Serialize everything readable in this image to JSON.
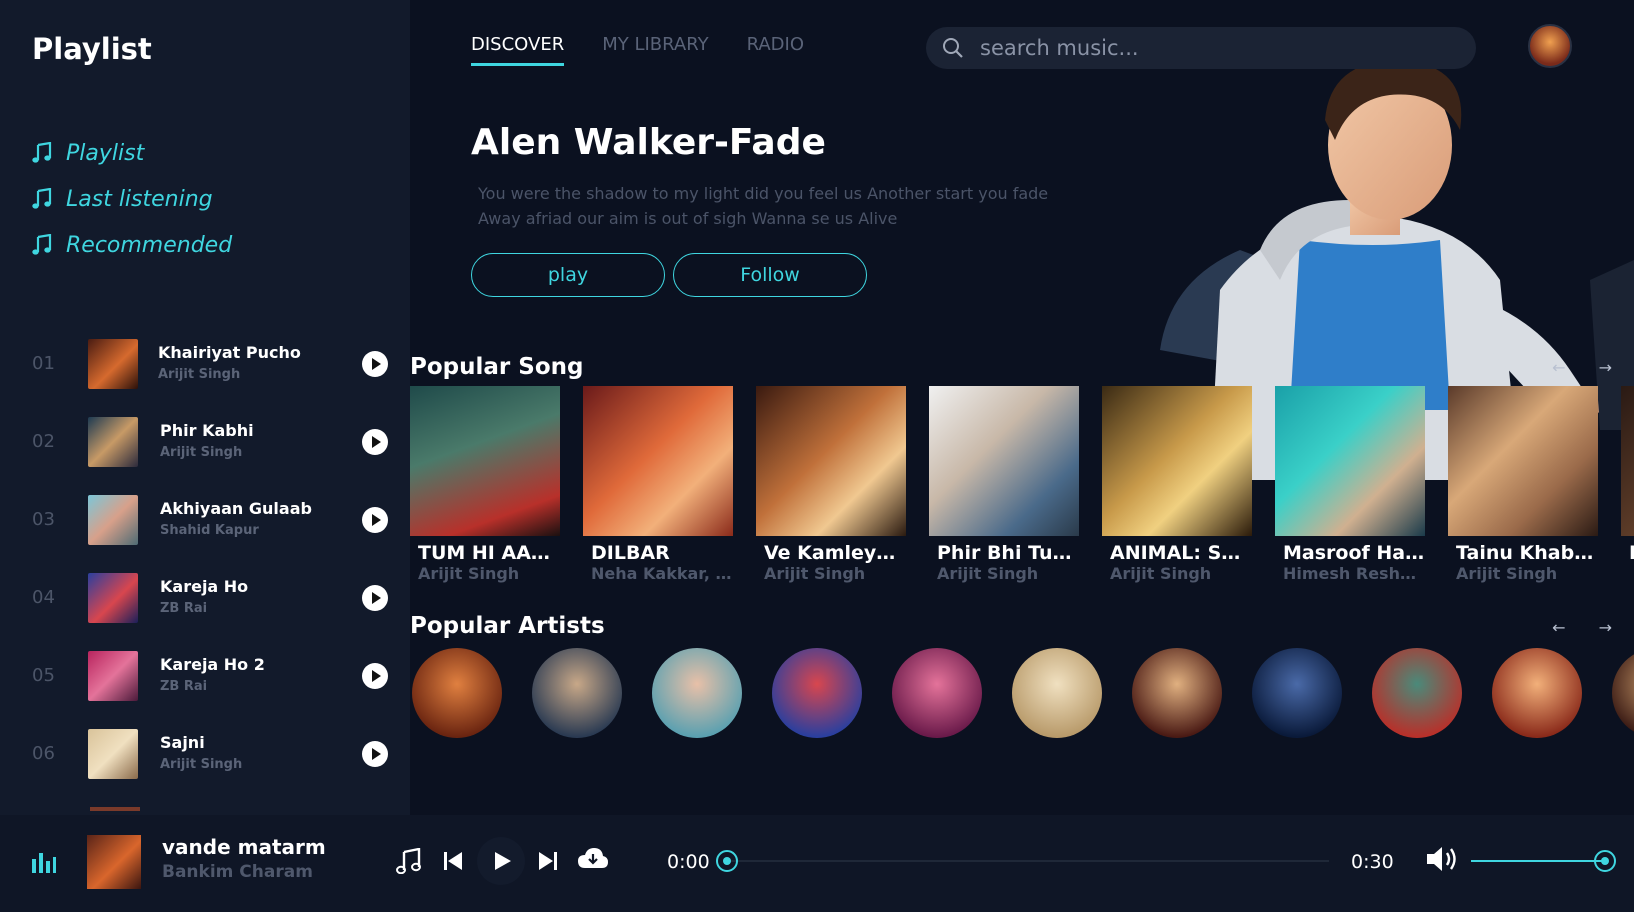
{
  "app_title": "Playlist",
  "nav": [
    {
      "label": "Playlist",
      "icon": "music-note-icon"
    },
    {
      "label": "Last listening",
      "icon": "music-note-icon"
    },
    {
      "label": "Recommended",
      "icon": "music-note-icon"
    }
  ],
  "playlist": [
    {
      "num": "01",
      "title": "Khairiyat Pucho",
      "artist": "Arijit Singh"
    },
    {
      "num": "02",
      "title": "Phir Kabhi",
      "artist": "Arijit Singh"
    },
    {
      "num": "03",
      "title": "Akhiyaan Gulaab",
      "artist": "Shahid Kapur"
    },
    {
      "num": "04",
      "title": "Kareja Ho",
      "artist": "ZB Rai"
    },
    {
      "num": "05",
      "title": "Kareja Ho 2",
      "artist": "ZB Rai"
    },
    {
      "num": "06",
      "title": "Sajni",
      "artist": "Arijit Singh"
    }
  ],
  "tabs": [
    {
      "label": "DISCOVER",
      "active": true
    },
    {
      "label": "MY LIBRARY",
      "active": false
    },
    {
      "label": "RADIO",
      "active": false
    }
  ],
  "search": {
    "placeholder": "search music..."
  },
  "hero": {
    "title": "Alen Walker-Fade",
    "desc_line1": "You were the shadow to my light did you feel us Another start you fade",
    "desc_line2": "Away afriad our aim is out of sigh Wanna se us Alive",
    "play_label": "play",
    "follow_label": "Follow"
  },
  "popular_song": {
    "title": "Popular Song",
    "arrows": "← →",
    "cards": [
      {
        "title": "TUM HI AANA",
        "artist": "Arijit Singh"
      },
      {
        "title": "DILBAR",
        "artist": "Neha Kakkar, ..."
      },
      {
        "title": "Ve Kamleya ...",
        "artist": "Arijit Singh"
      },
      {
        "title": "Phir Bhi Tum...",
        "artist": "Arijit Singh"
      },
      {
        "title": "ANIMAL: SAT...",
        "artist": "Arijit Singh"
      },
      {
        "title": "Masroof Hai ...",
        "artist": "Himesh Resha..."
      },
      {
        "title": "Tainu Khaba...",
        "artist": "Arijit Singh"
      },
      {
        "title": "B",
        "artist": ""
      }
    ]
  },
  "popular_artists": {
    "title": "Popular Artists",
    "arrows": "← →",
    "count": 11
  },
  "now_playing": {
    "title": "vande matarm",
    "artist": "Bankim Charam",
    "current_time": "0:00",
    "duration": "0:30",
    "progress": 0,
    "volume": 1.0
  },
  "colors": {
    "accent": "#3fd6e0",
    "background": "#0b1120",
    "sidebar": "#121a2b"
  }
}
